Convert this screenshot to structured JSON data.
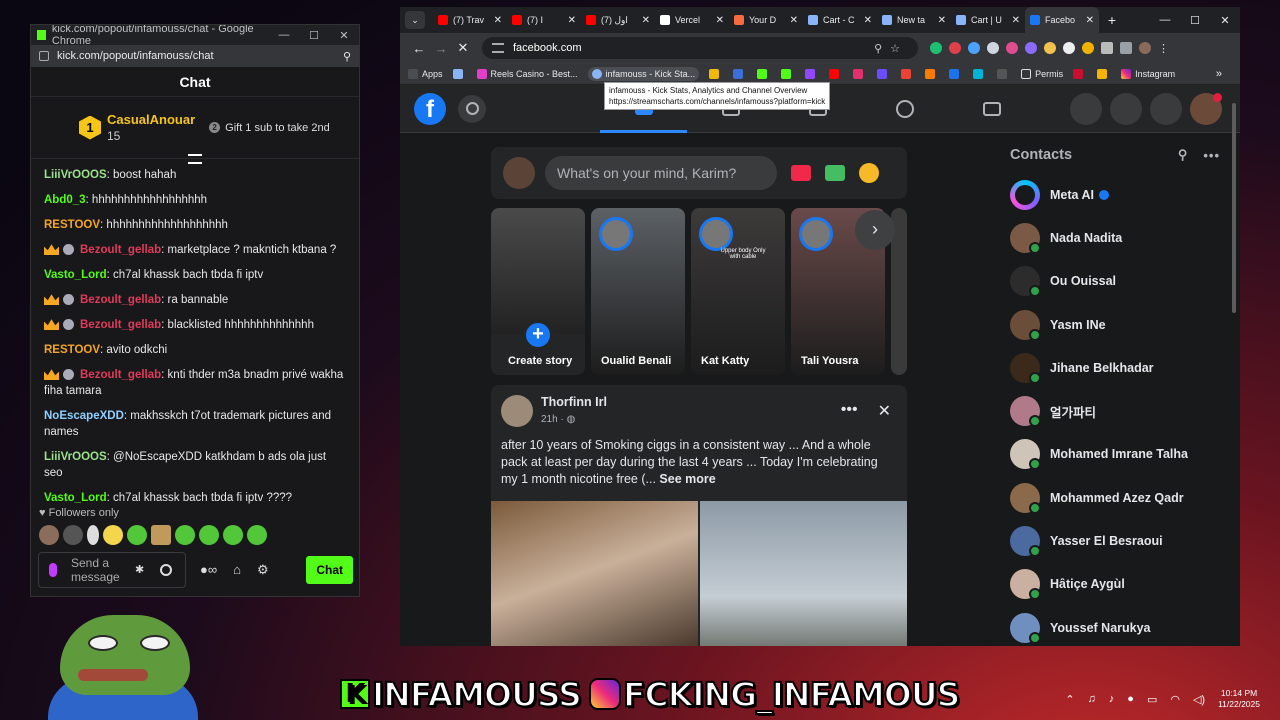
{
  "kick_window": {
    "title": "kick.com/popout/infamouss/chat - Google Chrome",
    "url": "kick.com/popout/infamouss/chat",
    "header": "Chat",
    "pinned": {
      "rank": "1",
      "name": "CasualAnouar",
      "count": "15",
      "gift_text": "Gift 1 sub to take 2nd"
    },
    "messages": [
      {
        "user": "LiiiVrOOOS",
        "color": "#9be28a",
        "text": ": boost hahah",
        "badges": ""
      },
      {
        "user": "Abd0_3",
        "color": "#53fc18",
        "text": ": hhhhhhhhhhhhhhhhhh",
        "badges": ""
      },
      {
        "user": "RESTOOV",
        "color": "#f5a623",
        "text": ": hhhhhhhhhhhhhhhhhhh",
        "badges": ""
      },
      {
        "user": "Bezoult_gellab",
        "color": "#e23a5a",
        "text": ": marketplace ? makntich ktbana ?",
        "badges": "crown"
      },
      {
        "user": "Vasto_Lord",
        "color": "#53fc18",
        "text": ": ch7al khassk bach tbda fi iptv",
        "badges": ""
      },
      {
        "user": "Bezoult_gellab",
        "color": "#e23a5a",
        "text": ": ra bannable",
        "badges": "crown"
      },
      {
        "user": "Bezoult_gellab",
        "color": "#e23a5a",
        "text": ": blacklisted hhhhhhhhhhhhhh",
        "badges": "crown"
      },
      {
        "user": "RESTOOV",
        "color": "#f5a623",
        "text": ": avito odkchi",
        "badges": ""
      },
      {
        "user": "Bezoult_gellab",
        "color": "#e23a5a",
        "text": ": knti thder m3a bnadm privé wakha fiha tamara",
        "badges": "crown"
      },
      {
        "user": "NoEscapeXDD",
        "color": "#8fd0ff",
        "text": ": makhsskch t7ot trademark pictures and names",
        "badges": ""
      },
      {
        "user": "LiiiVrOOOS",
        "color": "#9be28a",
        "text": ": @NoEscapeXDD katkhdam b ads ola just seo",
        "badges": ""
      },
      {
        "user": "Vasto_Lord",
        "color": "#53fc18",
        "text": ": ch7al khassk bach tbda fi iptv ????",
        "badges": ""
      }
    ],
    "followers_only": "Followers only",
    "input_placeholder": "Send a message",
    "chat_button": "Chat"
  },
  "browser": {
    "tabs": [
      {
        "label": "(7) Trav",
        "color": "#ff0000"
      },
      {
        "label": "(7) I",
        "color": "#ff0000"
      },
      {
        "label": "(7) اول",
        "color": "#ff0000"
      },
      {
        "label": "Vercel",
        "color": "#ffffff"
      },
      {
        "label": "Your D",
        "color": "#f96a3e"
      },
      {
        "label": "Cart - C",
        "color": "#8ab4f8"
      },
      {
        "label": "New ta",
        "color": "#8ab4f8"
      },
      {
        "label": "Cart | U",
        "color": "#8ab4f8"
      },
      {
        "label": "Facebo",
        "color": "#1877f2"
      }
    ],
    "url": "facebook.com",
    "bookmarks": [
      "Apps",
      "Reels Casino - Best...",
      "infamouss - Kick Sta...",
      "Permis",
      "Instagram"
    ],
    "tooltip": {
      "line1": "infamouss - Kick Stats, Analytics and Channel Overview",
      "line2": "https://streamscharts.com/channels/infamouss?platform=kick"
    }
  },
  "facebook": {
    "composer_placeholder": "What's on your mind, Karim?",
    "stories": [
      {
        "name": "Create story",
        "bg": "#3a3a3a"
      },
      {
        "name": "Oualid Benali",
        "bg": "#5c6166"
      },
      {
        "name": "Kat Katty",
        "bg": "#3d3a3a"
      },
      {
        "name": "Tali Yousra",
        "bg": "#6a4a4a"
      }
    ],
    "story_caption": "Upper body Only with cable",
    "post": {
      "author": "Thorfinn Irl",
      "time": "21h",
      "text": "after 10 years of Smoking ciggs in a consistent way ... And a whole pack at least per day during  the last  4 years ... Today I'm celebrating my 1 month nicotine free (...",
      "see_more": "See more"
    },
    "contacts_title": "Contacts",
    "contacts": [
      {
        "name": "Meta AI",
        "color": "#6f5cff",
        "online": false
      },
      {
        "name": "Nada Nadita",
        "color": "#7a5a46",
        "online": true
      },
      {
        "name": "Ou Ouissal",
        "color": "#2c2c2c",
        "online": true
      },
      {
        "name": "Yasm INe",
        "color": "#6b4e3a",
        "online": true
      },
      {
        "name": "Jihane Belkhadar",
        "color": "#3b2a1a",
        "online": true
      },
      {
        "name": "얼가파티",
        "color": "#b07a8a",
        "online": true
      },
      {
        "name": "Mohamed Imrane Talha",
        "color": "#cfc4b8",
        "online": true
      },
      {
        "name": "Mohammed Azez Qadr",
        "color": "#8a6a4a",
        "online": true
      },
      {
        "name": "Yasser El Besraoui",
        "color": "#4a6aa0",
        "online": true
      },
      {
        "name": "Hâtiçe Aygùl",
        "color": "#c9b0a0",
        "online": true
      },
      {
        "name": "Youssef Narukya",
        "color": "#6f8fbf",
        "online": true
      }
    ]
  },
  "overlay": {
    "brand_left": "INFAMOUSS",
    "brand_right": "FCKING_INFAMOUS",
    "k_letter": "K"
  },
  "tray": {
    "time": "10:14 PM",
    "date": "11/22/2025"
  }
}
